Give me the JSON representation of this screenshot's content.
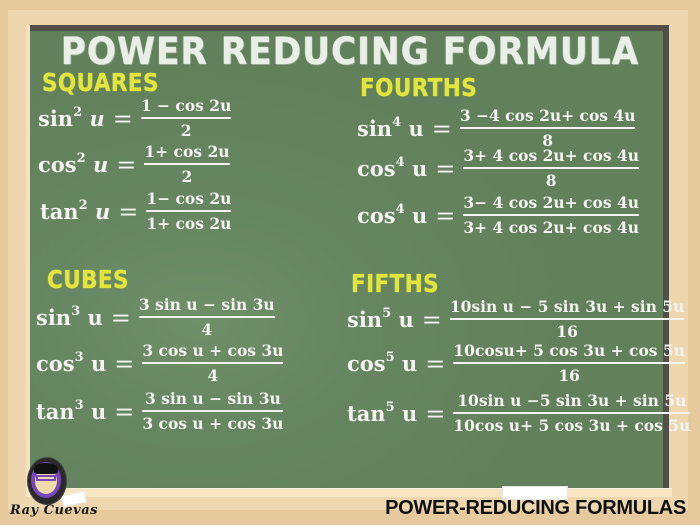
{
  "title": "POWER REDUCING FORMULA",
  "footer": {
    "caption": "POWER-REDUCING FORMULAS",
    "author": "Ray Cuevas"
  },
  "colors": {
    "board": "#62805b",
    "frame": "#eed7af",
    "background": "#e7c99e",
    "board_border": "#544e48",
    "section_title": "#e2e63a",
    "chalk_text": "#f3f3ef"
  },
  "sections": {
    "squares": {
      "title": "SQUARES",
      "formulas": [
        {
          "func": "sin",
          "power": "2",
          "var": "u",
          "numerator": "1 − cos 2u",
          "denominator": "2"
        },
        {
          "func": "cos",
          "power": "2",
          "var": "u",
          "numerator": "1+ cos 2u",
          "denominator": "2"
        },
        {
          "func": "tan",
          "power": "2",
          "var": "u",
          "numerator": "1− cos 2u",
          "denominator": "1+ cos 2u"
        }
      ]
    },
    "fourths": {
      "title": "FOURTHS",
      "formulas": [
        {
          "func": "sin",
          "power": "4",
          "var": "u",
          "numerator": "3 −4 cos 2u+ cos 4u",
          "denominator": "8"
        },
        {
          "func": "cos",
          "power": "4",
          "var": "u",
          "numerator": "3+ 4 cos 2u+ cos 4u",
          "denominator": "8"
        },
        {
          "func": "cos",
          "power": "4",
          "var": "u",
          "numerator": "3− 4 cos 2u+ cos 4u",
          "denominator": "3+ 4 cos 2u+ cos 4u"
        }
      ]
    },
    "cubes": {
      "title": "CUBES",
      "formulas": [
        {
          "func": "sin",
          "power": "3",
          "var": "u",
          "numerator": "3 sin u − sin 3u",
          "denominator": "4"
        },
        {
          "func": "cos",
          "power": "3",
          "var": "u",
          "numerator": "3 cos u + cos 3u",
          "denominator": "4"
        },
        {
          "func": "tan",
          "power": "3",
          "var": "u",
          "numerator": "3 sin u − sin 3u",
          "denominator": "3 cos u + cos 3u"
        }
      ]
    },
    "fifths": {
      "title": "FIFTHS",
      "formulas": [
        {
          "func": "sin",
          "power": "5",
          "var": "u",
          "numerator": "10sin u − 5 sin 3u + sin 5u",
          "denominator": "16"
        },
        {
          "func": "cos",
          "power": "5",
          "var": "u",
          "numerator": "10cosu+ 5 cos 3u + cos 5u",
          "denominator": "16"
        },
        {
          "func": "tan",
          "power": "5",
          "var": "u",
          "numerator": "10sin u −5 sin 3u + sin  5u",
          "denominator": "10cos u+ 5 cos 3u + cos 5u"
        }
      ]
    }
  },
  "equals_sign": "="
}
